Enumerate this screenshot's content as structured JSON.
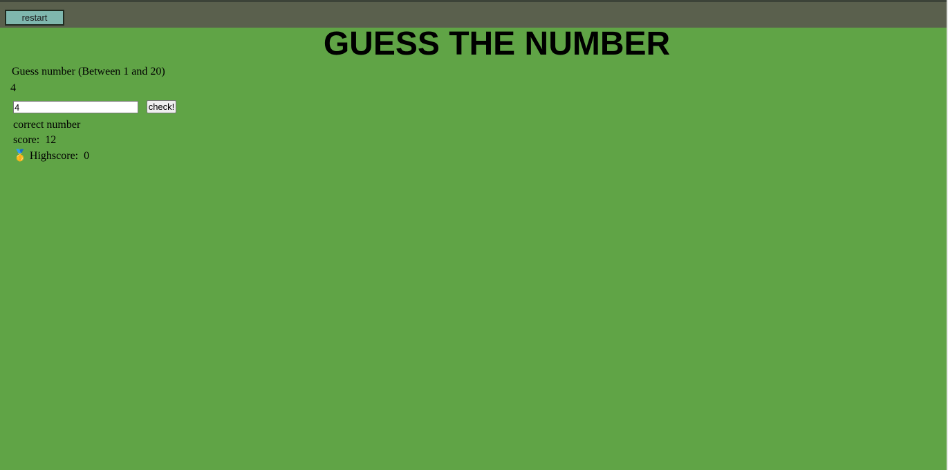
{
  "header": {
    "restart_label": "restart"
  },
  "title": "GUESS THE NUMBER",
  "prompt": "Guess number (Between 1 and 20)",
  "guess_display": "4",
  "guess_input": {
    "value": "4"
  },
  "check_label": "check!",
  "message": "correct number",
  "score": {
    "label": "score:",
    "value": "12"
  },
  "highscore": {
    "icon": "🥇",
    "label": "Highscore:",
    "value": "0"
  },
  "colors": {
    "background": "#60a446",
    "topbar": "#5a604d",
    "restart_button": "#7fb7ae"
  }
}
